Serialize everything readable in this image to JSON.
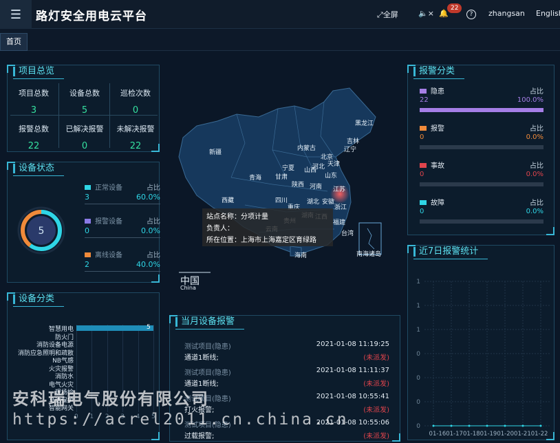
{
  "header": {
    "title": "路灯安全用电云平台",
    "fullscreen_label": "全屏",
    "notification_count": "22",
    "username": "zhangsan",
    "language": "English"
  },
  "tabs": [
    {
      "label": "首页"
    }
  ],
  "project_overview": {
    "title": "项目总览",
    "stats": [
      {
        "label": "项目总数",
        "value": "3"
      },
      {
        "label": "设备总数",
        "value": "5"
      },
      {
        "label": "巡检次数",
        "value": "0"
      },
      {
        "label": "报警总数",
        "value": "22"
      },
      {
        "label": "已解决报警",
        "value": "0"
      },
      {
        "label": "未解决报警",
        "value": "22"
      }
    ]
  },
  "device_status": {
    "title": "设备状态",
    "total": "5",
    "pct_header": "占比",
    "items": [
      {
        "name": "正常设备",
        "count": "3",
        "pct": "60.0%",
        "color": "#2fd6e6"
      },
      {
        "name": "报警设备",
        "count": "0",
        "pct": "0.0%",
        "color": "#8a7ae6"
      },
      {
        "name": "离线设备",
        "count": "2",
        "pct": "40.0%",
        "color": "#f08a3a"
      }
    ]
  },
  "device_category": {
    "title": "设备分类",
    "categories": [
      "智慧用电",
      "防火门",
      "消防设备电源",
      "消防应急照明和疏散",
      "NB气感",
      "火灾报警",
      "消防水",
      "电气火灾",
      "现场检",
      "马达保护",
      "智能网关"
    ],
    "values": [
      5,
      0,
      0,
      0,
      0,
      0,
      0,
      0,
      0,
      0,
      0
    ],
    "xticks": [
      "0",
      "1",
      "2",
      "3",
      "4",
      "5"
    ],
    "bar_label": "5"
  },
  "map": {
    "country_label": "中国",
    "country_sub": "China",
    "provinces": [
      {
        "name": "黑龙江"
      },
      {
        "name": "吉林"
      },
      {
        "name": "辽宁"
      },
      {
        "name": "内蒙古"
      },
      {
        "name": "新疆"
      },
      {
        "name": "北京"
      },
      {
        "name": "天津"
      },
      {
        "name": "河北"
      },
      {
        "name": "宁夏"
      },
      {
        "name": "山西"
      },
      {
        "name": "山东"
      },
      {
        "name": "青海"
      },
      {
        "name": "甘肃"
      },
      {
        "name": "陕西"
      },
      {
        "name": "河南"
      },
      {
        "name": "江苏"
      },
      {
        "name": "西藏"
      },
      {
        "name": "四川"
      },
      {
        "name": "湖北"
      },
      {
        "name": "安徽"
      },
      {
        "name": "重庆"
      },
      {
        "name": "浙江"
      },
      {
        "name": "贵州"
      },
      {
        "name": "湖南"
      },
      {
        "name": "江西"
      },
      {
        "name": "福建"
      },
      {
        "name": "云南"
      },
      {
        "name": "台湾"
      },
      {
        "name": "海南"
      },
      {
        "name": "南海诸岛"
      }
    ],
    "tooltip": {
      "line1": "站点名称：分项计量",
      "line2": "负责人：",
      "line3": "所在位置：上海市上海嘉定区育绿路"
    }
  },
  "monthly_alarms": {
    "title": "当月设备报警",
    "items": [
      {
        "project": "测试项目(隐患)",
        "time": "2021-01-08 11:19:25",
        "content": "通道1断线;",
        "status": "(未派发)"
      },
      {
        "project": "测试项目(隐患)",
        "time": "2021-01-08 11:11:37",
        "content": "通道1断线;",
        "status": "(未派发)"
      },
      {
        "project": "测试项目(隐患)",
        "time": "2021-01-08 10:55:41",
        "content": "打火报警;",
        "status": "(未派发)"
      },
      {
        "project": "测试项目(隐患)",
        "time": "2021-01-08 10:55:06",
        "content": "过载报警;",
        "status": "(未派发)"
      }
    ]
  },
  "alarm_category": {
    "title": "报警分类",
    "pct_header": "占比",
    "items": [
      {
        "name": "隐患",
        "count": "22",
        "pct": "100.0%",
        "fraction": 1.0,
        "color": "#a57ee6",
        "num_color": "#a57ee6"
      },
      {
        "name": "报警",
        "count": "0",
        "pct": "0.0%",
        "fraction": 0,
        "color": "#f08a3a",
        "num_color": "#f08a3a"
      },
      {
        "name": "事故",
        "count": "0",
        "pct": "0.0%",
        "fraction": 0,
        "color": "#e0444c",
        "num_color": "#e0444c"
      },
      {
        "name": "故障",
        "count": "0",
        "pct": "0.0%",
        "fraction": 0,
        "color": "#2fd6e6",
        "num_color": "#2fd6e6"
      }
    ]
  },
  "weekly_alarms": {
    "title": "近7日报警统计"
  },
  "chart_data": {
    "type": "line",
    "x": [
      "01-16",
      "01-17",
      "01-18",
      "01-19",
      "01-20",
      "01-21",
      "01-22"
    ],
    "series": [
      {
        "values": [
          0,
          0,
          0,
          0,
          0,
          0,
          0
        ]
      }
    ],
    "yticks": [
      "0",
      "0",
      "0",
      "0",
      "1",
      "1",
      "1"
    ],
    "ylim": [
      0,
      1
    ]
  },
  "watermark": {
    "line1": "安科瑞电气股份有限公司",
    "line2": "https://acrel2011.cn.china.cn"
  }
}
